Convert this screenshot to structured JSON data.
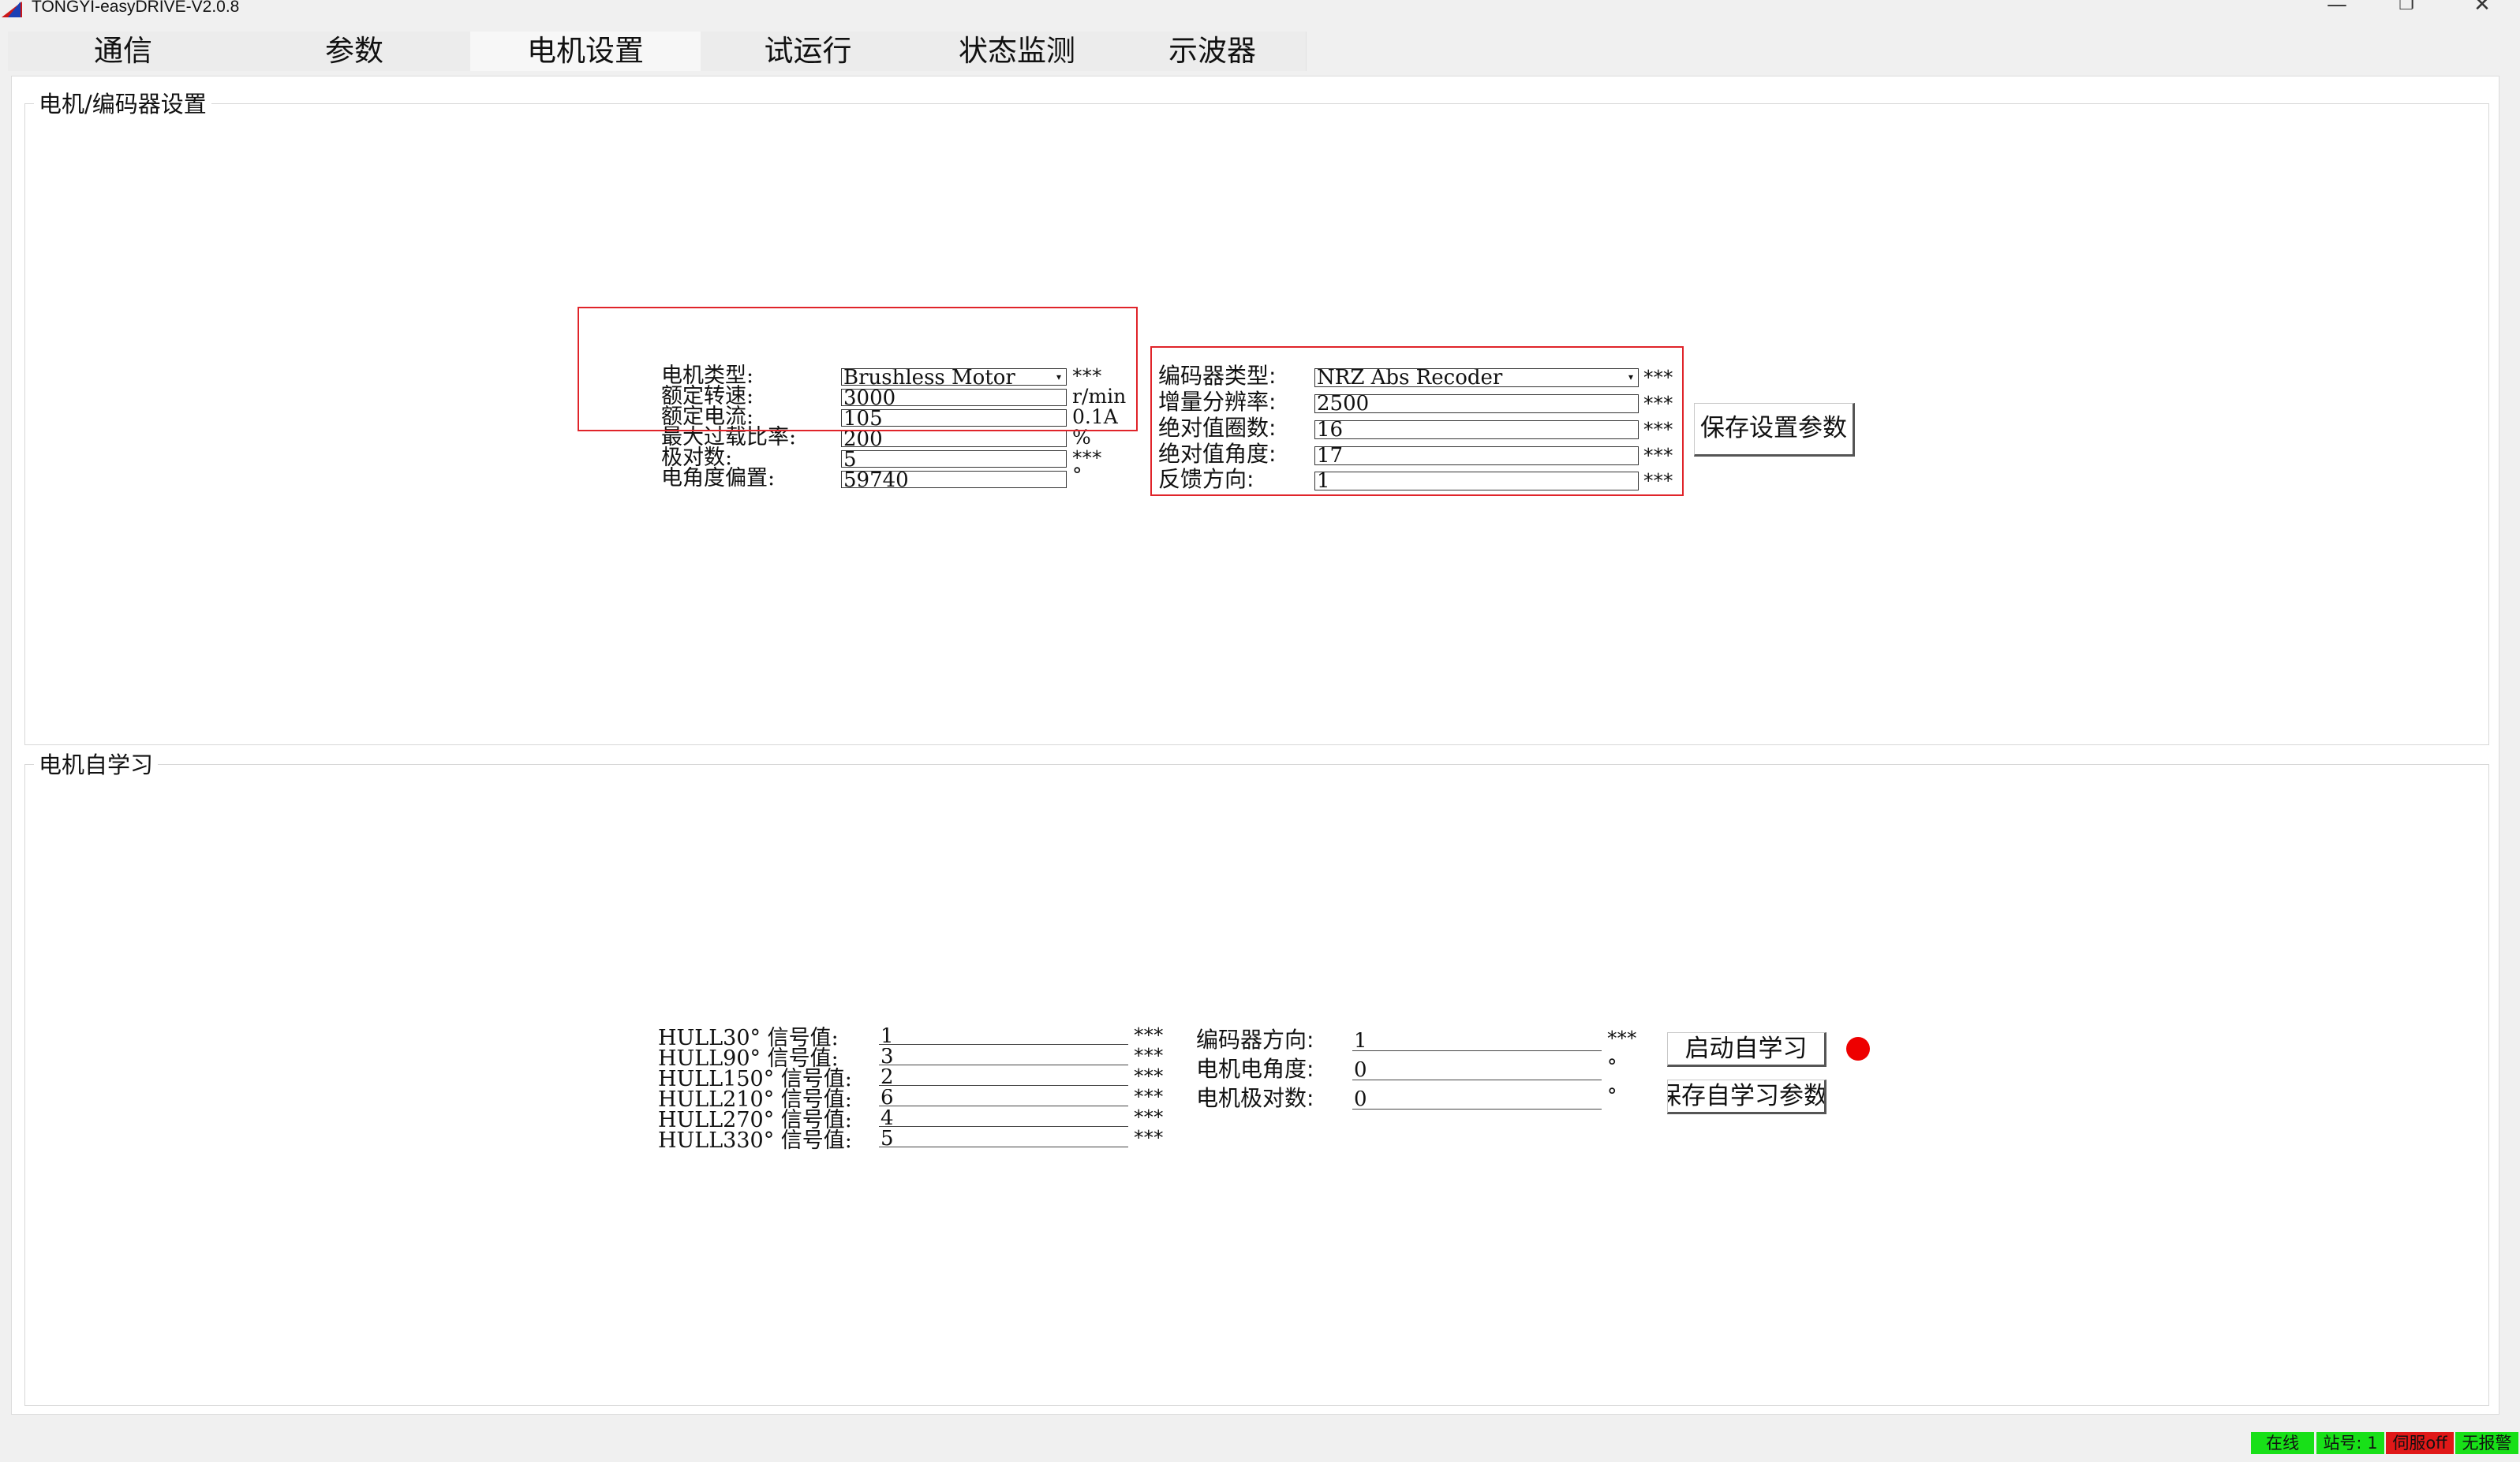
{
  "window": {
    "title": "TONGYI-easyDRIVE-V2.0.8",
    "controls": {
      "minimize": "—",
      "restore": "❐",
      "close": "✕"
    }
  },
  "tabs": [
    {
      "label": "通信"
    },
    {
      "label": "参数"
    },
    {
      "label": "电机设置",
      "active": true
    },
    {
      "label": "试运行"
    },
    {
      "label": "状态监测"
    },
    {
      "label": "示波器"
    }
  ],
  "motor_encoder": {
    "title": "电机/编码器设置",
    "motor": {
      "type": {
        "label": "电机类型:",
        "value": "Brushless Motor",
        "suffix": "***"
      },
      "rated_speed": {
        "label": "额定转速:",
        "value": "3000",
        "suffix": "r/min"
      },
      "rated_current": {
        "label": "额定电流:",
        "value": "105",
        "suffix": "0.1A"
      },
      "max_overload": {
        "label": "最大过载比率:",
        "value": "200",
        "suffix": "%"
      },
      "pole_pairs": {
        "label": "极对数:",
        "value": "5",
        "suffix": "***"
      },
      "elec_angle_offset": {
        "label": "电角度偏置:",
        "value": "59740",
        "suffix": "°"
      }
    },
    "encoder": {
      "type": {
        "label": "编码器类型:",
        "value": "NRZ Abs Recoder",
        "suffix": "***"
      },
      "resolution": {
        "label": "增量分辨率:",
        "value": "2500",
        "suffix": "***"
      },
      "abs_turns": {
        "label": "绝对值圈数:",
        "value": "16",
        "suffix": "***"
      },
      "abs_angle": {
        "label": "绝对值角度:",
        "value": "17",
        "suffix": "***"
      },
      "feedback_dir": {
        "label": "反馈方向:",
        "value": "1",
        "suffix": "***"
      }
    },
    "save_button": "保存设置参数"
  },
  "self_learning": {
    "title": "电机自学习",
    "hall": [
      {
        "label": "HULL30° 信号值:",
        "value": "1",
        "suffix": "***"
      },
      {
        "label": "HULL90° 信号值:",
        "value": "3",
        "suffix": "***"
      },
      {
        "label": "HULL150° 信号值:",
        "value": "2",
        "suffix": "***"
      },
      {
        "label": "HULL210° 信号值:",
        "value": "6",
        "suffix": "***"
      },
      {
        "label": "HULL270° 信号值:",
        "value": "4",
        "suffix": "***"
      },
      {
        "label": "HULL330° 信号值:",
        "value": "5",
        "suffix": "***"
      }
    ],
    "encoder_dir": {
      "label": "编码器方向:",
      "value": "1",
      "suffix": "***"
    },
    "motor_elec_angle": {
      "label": "电机电角度:",
      "value": "0",
      "suffix": "°"
    },
    "motor_pole_pairs": {
      "label": "电机极对数:",
      "value": "0",
      "suffix": "°"
    },
    "start_button": "启动自学习",
    "save_button": "保存自学习参数",
    "indicator_color": "#ee0000"
  },
  "statusbar": {
    "online": {
      "text": "在线",
      "color": "#18e018"
    },
    "station": {
      "text": "站号: 1",
      "color": "#18e018"
    },
    "servo": {
      "text": "伺服off",
      "color": "#e01818"
    },
    "alarm": {
      "text": "无报警",
      "color": "#18e018"
    }
  }
}
